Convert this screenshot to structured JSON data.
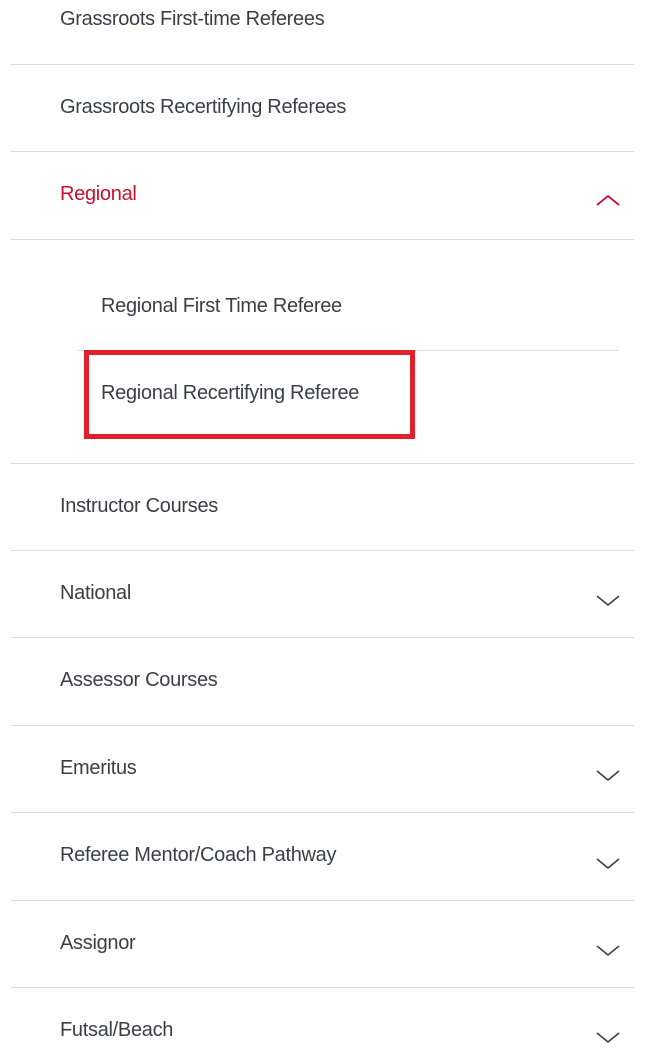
{
  "menu": {
    "items": [
      {
        "label": "Grassroots First-time Referees",
        "expandable": false
      },
      {
        "label": "Grassroots Recertifying Referees",
        "expandable": false
      },
      {
        "label": "Regional",
        "expandable": true,
        "expanded": true,
        "children": [
          {
            "label": "Regional First Time Referee"
          },
          {
            "label": "Regional Recertifying Referee",
            "highlighted": true
          }
        ]
      },
      {
        "label": "Instructor Courses",
        "expandable": false
      },
      {
        "label": "National",
        "expandable": true,
        "expanded": false
      },
      {
        "label": "Assessor Courses",
        "expandable": false
      },
      {
        "label": "Emeritus",
        "expandable": true,
        "expanded": false
      },
      {
        "label": "Referee Mentor/Coach Pathway",
        "expandable": true,
        "expanded": false
      },
      {
        "label": "Assignor",
        "expandable": true,
        "expanded": false
      },
      {
        "label": "Futsal/Beach",
        "expandable": true,
        "expanded": false
      }
    ]
  },
  "icons": {
    "expanded": "chevron-up-icon",
    "collapsed": "chevron-down-icon"
  },
  "colors": {
    "active_text": "#c8102e",
    "text": "#3a3f47",
    "divider": "#dcdcdc",
    "highlight_border": "#e2202c"
  }
}
